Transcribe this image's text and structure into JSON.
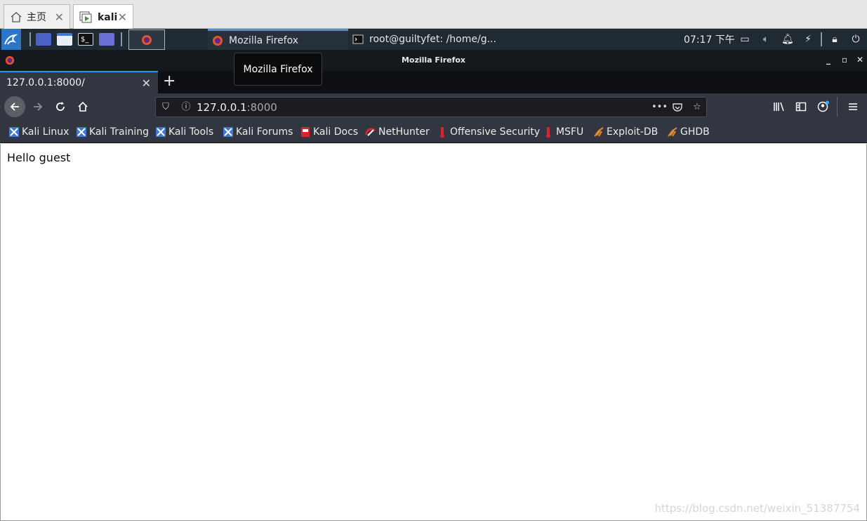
{
  "vm_tabs": [
    {
      "label": "主页",
      "icon": "home-icon"
    },
    {
      "label": "kali",
      "icon": "vm-icon"
    }
  ],
  "panel": {
    "tasks": [
      {
        "label": "Mozilla Firefox",
        "icon": "firefox-icon"
      },
      {
        "label": "root@guiltyfet: /home/g...",
        "icon": "terminal-icon"
      }
    ],
    "clock": "07:17 下午"
  },
  "firefox": {
    "window_title": "Mozilla Firefox",
    "tooltip": "Mozilla Firefox",
    "tab_title": "127.0.0.1:8000/",
    "url_host": "127.0.0.1",
    "url_port": ":8000",
    "bookmarks": [
      {
        "label": "Kali Linux",
        "icon": "kali-bookmark-icon"
      },
      {
        "label": "Kali Training",
        "icon": "kali-bookmark-icon"
      },
      {
        "label": "Kali Tools",
        "icon": "kali-bookmark-icon"
      },
      {
        "label": "Kali Forums",
        "icon": "kali-bookmark-icon"
      },
      {
        "label": "Kali Docs",
        "icon": "kali-docs-icon"
      },
      {
        "label": "NetHunter",
        "icon": "nethunter-icon"
      },
      {
        "label": "Offensive Security",
        "icon": "offsec-icon"
      },
      {
        "label": "MSFU",
        "icon": "offsec-icon"
      },
      {
        "label": "Exploit-DB",
        "icon": "exploitdb-icon"
      },
      {
        "label": "GHDB",
        "icon": "exploitdb-icon"
      }
    ]
  },
  "page": {
    "message": "Hello guest"
  },
  "watermark": "https://blog.csdn.net/weixin_51387754",
  "colors": {
    "panel": "#1f2a33",
    "toolbar": "#323640",
    "accent": "#2e8ff0"
  }
}
